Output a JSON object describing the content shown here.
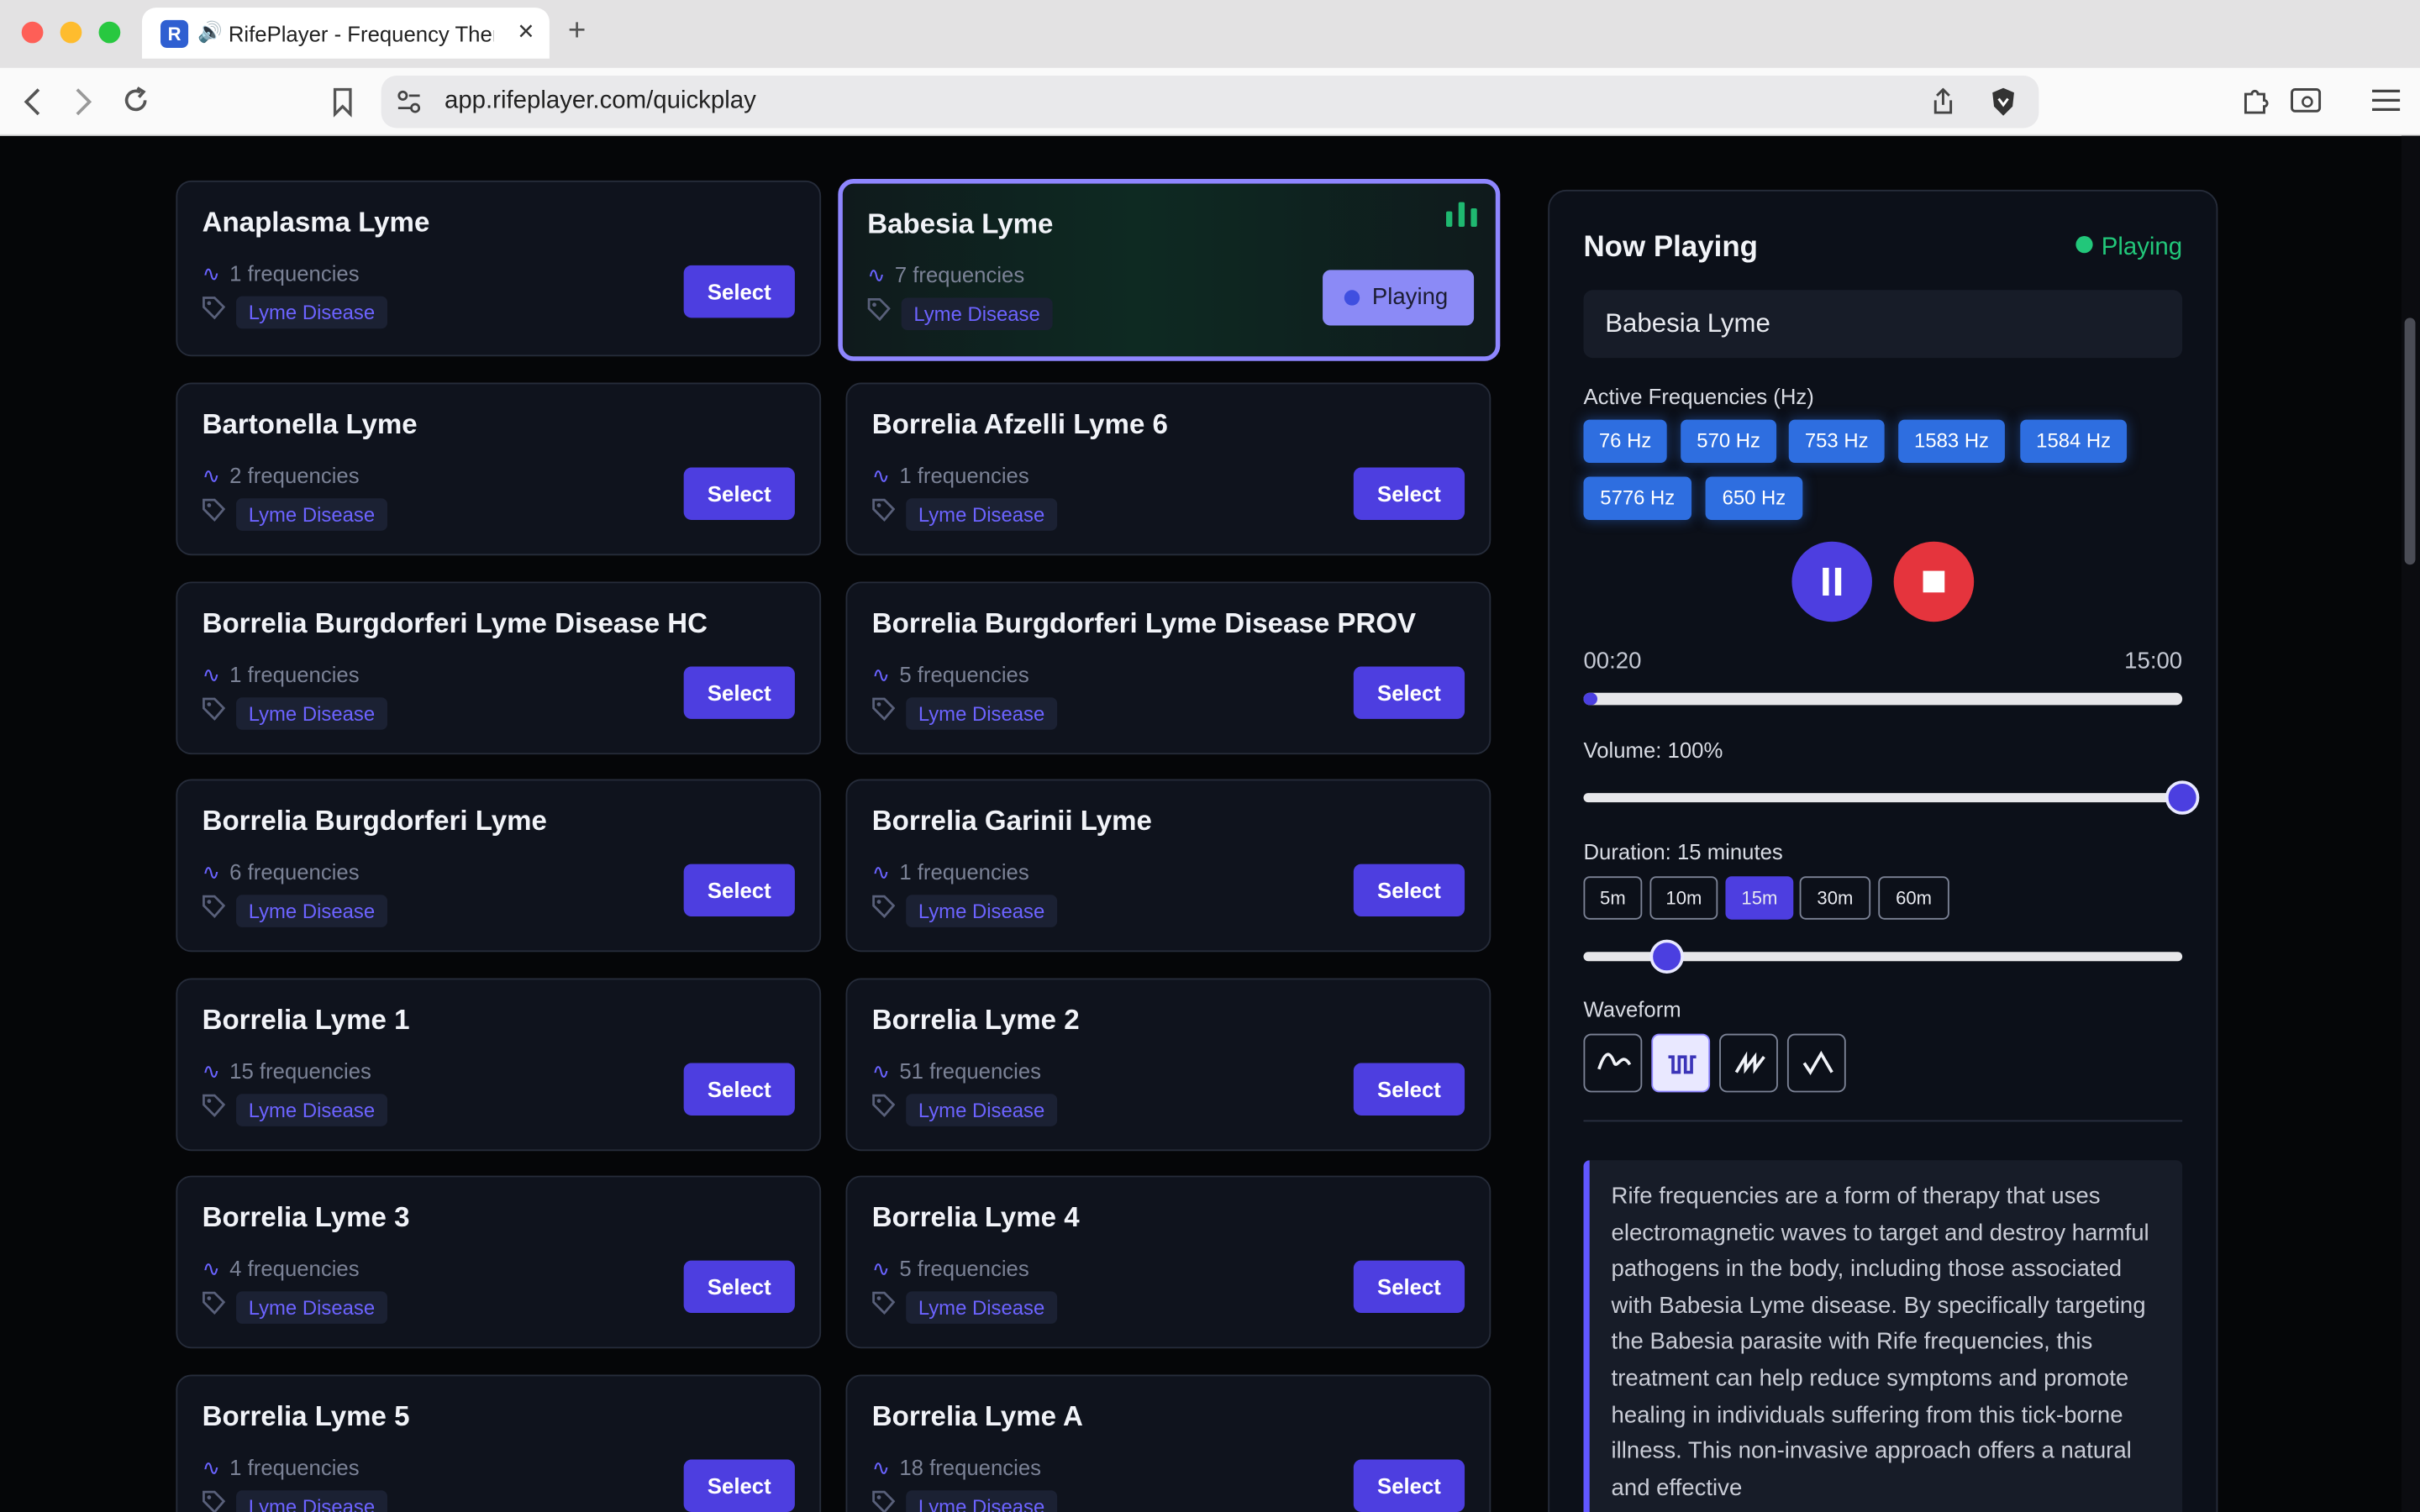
{
  "browser": {
    "tab_title": "RifePlayer - Frequency Ther",
    "url": "app.rifeplayer.com/quickplay",
    "favicon_letter": "R"
  },
  "programs": [
    {
      "name": "Anaplasma Lyme",
      "freq_label": "1 frequencies",
      "tag": "Lyme Disease",
      "action": "Select"
    },
    {
      "name": "Babesia Lyme",
      "freq_label": "7 frequencies",
      "tag": "Lyme Disease",
      "action": "Playing"
    },
    {
      "name": "Bartonella Lyme",
      "freq_label": "2 frequencies",
      "tag": "Lyme Disease",
      "action": "Select"
    },
    {
      "name": "Borrelia Afzelli Lyme 6",
      "freq_label": "1 frequencies",
      "tag": "Lyme Disease",
      "action": "Select"
    },
    {
      "name": "Borrelia Burgdorferi Lyme Disease HC",
      "freq_label": "1 frequencies",
      "tag": "Lyme Disease",
      "action": "Select"
    },
    {
      "name": "Borrelia Burgdorferi Lyme Disease PROV",
      "freq_label": "5 frequencies",
      "tag": "Lyme Disease",
      "action": "Select"
    },
    {
      "name": "Borrelia Burgdorferi Lyme",
      "freq_label": "6 frequencies",
      "tag": "Lyme Disease",
      "action": "Select"
    },
    {
      "name": "Borrelia Garinii Lyme",
      "freq_label": "1 frequencies",
      "tag": "Lyme Disease",
      "action": "Select"
    },
    {
      "name": "Borrelia Lyme 1",
      "freq_label": "15 frequencies",
      "tag": "Lyme Disease",
      "action": "Select"
    },
    {
      "name": "Borrelia Lyme 2",
      "freq_label": "51 frequencies",
      "tag": "Lyme Disease",
      "action": "Select"
    },
    {
      "name": "Borrelia Lyme 3",
      "freq_label": "4 frequencies",
      "tag": "Lyme Disease",
      "action": "Select"
    },
    {
      "name": "Borrelia Lyme 4",
      "freq_label": "5 frequencies",
      "tag": "Lyme Disease",
      "action": "Select"
    },
    {
      "name": "Borrelia Lyme 5",
      "freq_label": "1 frequencies",
      "tag": "Lyme Disease",
      "action": "Select"
    },
    {
      "name": "Borrelia Lyme A",
      "freq_label": "18 frequencies",
      "tag": "Lyme Disease",
      "action": "Select"
    }
  ],
  "now_playing": {
    "heading": "Now Playing",
    "status": "Playing",
    "program": "Babesia Lyme",
    "freq_heading": "Active Frequencies (Hz)",
    "frequencies": [
      "76 Hz",
      "570 Hz",
      "753 Hz",
      "1583 Hz",
      "1584 Hz",
      "5776 Hz",
      "650 Hz"
    ],
    "elapsed": "00:20",
    "total": "15:00",
    "progress": 0.022,
    "volume_label": "Volume: 100%",
    "volume": 1.0,
    "duration_label": "Duration: 15 minutes",
    "duration_options": [
      "5m",
      "10m",
      "15m",
      "30m",
      "60m"
    ],
    "duration_selected": "15m",
    "duration_slider": 0.14,
    "waveform_label": "Waveform",
    "waveforms": [
      "sine-wave-icon",
      "square-wave-icon",
      "sawtooth-wave-icon",
      "triangle-wave-icon"
    ],
    "waveform_selected": "square-wave-icon",
    "description": "Rife frequencies are a form of therapy that uses electromagnetic waves to target and destroy harmful pathogens in the body, including those associated with Babesia Lyme disease. By specifically targeting the Babesia parasite with Rife frequencies, this treatment can help reduce symptoms and promote healing in individuals suffering from this tick-borne illness. This non-invasive approach offers a natural and effective"
  },
  "colors": {
    "accent": "#4d3ee0",
    "playing": "#22c77a",
    "stop": "#e5343d",
    "chip": "#2e6ee0"
  }
}
